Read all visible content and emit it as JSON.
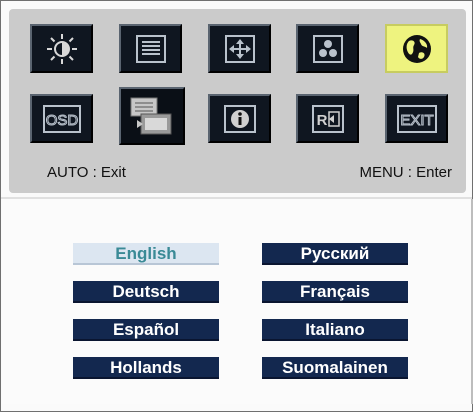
{
  "menu": {
    "icons": [
      {
        "name": "brightness-icon",
        "active": false
      },
      {
        "name": "image-adjust-icon",
        "active": false
      },
      {
        "name": "position-icon",
        "active": false
      },
      {
        "name": "color-icon",
        "active": false
      },
      {
        "name": "language-globe-icon",
        "active": true
      },
      {
        "name": "osd-settings-icon",
        "active": false
      },
      {
        "name": "input-source-icon",
        "active": false
      },
      {
        "name": "information-icon",
        "active": false
      },
      {
        "name": "reset-icon",
        "active": false
      },
      {
        "name": "exit-icon",
        "active": false
      }
    ],
    "osd_label": "OSD",
    "exit_label": "EXIT"
  },
  "footer": {
    "auto_hint": "AUTO : Exit",
    "menu_hint": "MENU : Enter"
  },
  "languages": {
    "selected": "English",
    "items": [
      "English",
      "Русский",
      "Deutsch",
      "Français",
      "Español",
      "Italiano",
      "Hollands",
      "Suomalainen"
    ]
  },
  "colors": {
    "panel": "#cbcbcb",
    "tile": "#0f1620",
    "active_tile": "#eef37f",
    "button": "#13284f",
    "selected_button": "#dce6f1",
    "selected_text": "#3a8a96"
  }
}
